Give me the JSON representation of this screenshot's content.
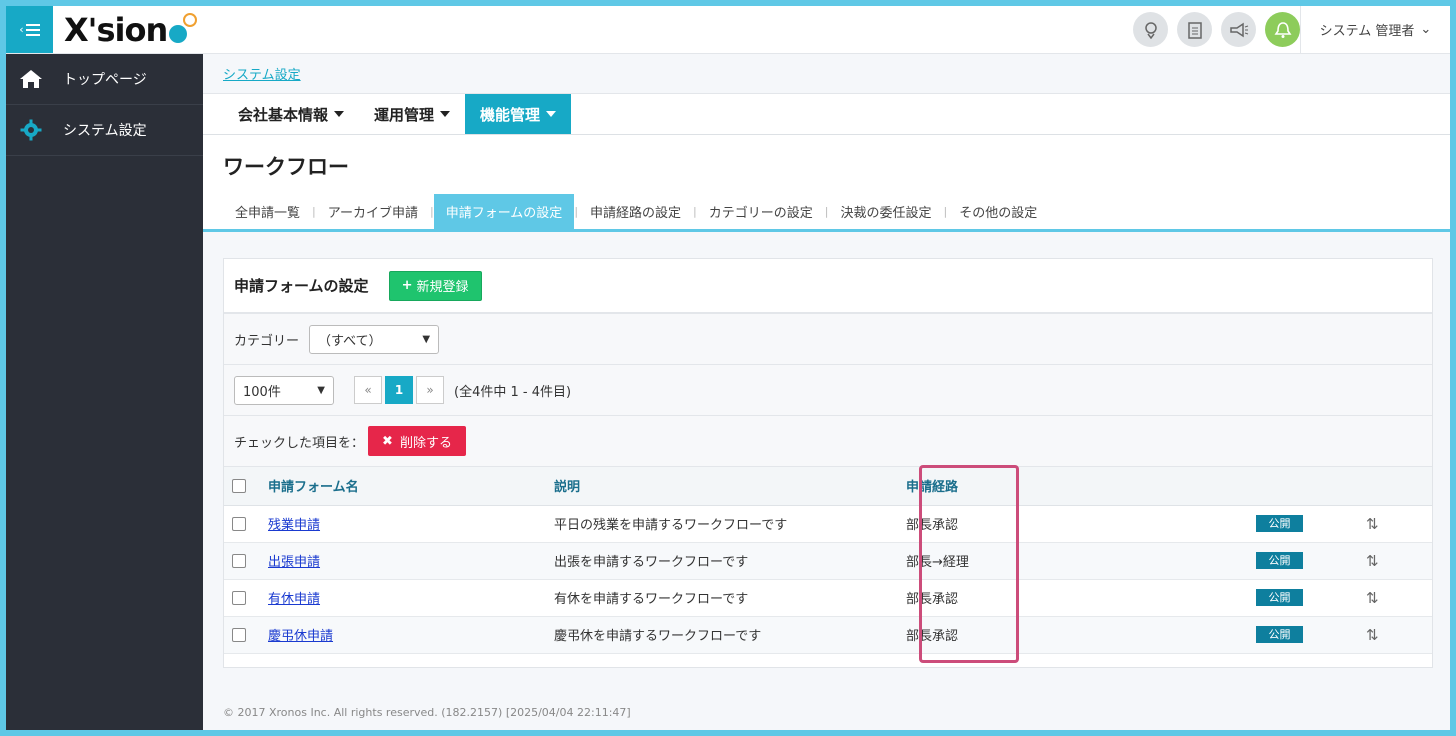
{
  "header": {
    "logo_text": "X'sion",
    "user_label": "システム 管理者",
    "icons": [
      "support-icon",
      "notepad-icon",
      "megaphone-icon",
      "bell-icon"
    ]
  },
  "sidebar": {
    "items": [
      {
        "label": "トップページ",
        "icon": "home-icon"
      },
      {
        "label": "システム設定",
        "icon": "gear-icon"
      }
    ]
  },
  "breadcrumb": {
    "label": "システム設定"
  },
  "mainnav": {
    "items": [
      {
        "label": "会社基本情報"
      },
      {
        "label": "運用管理"
      },
      {
        "label": "機能管理"
      }
    ]
  },
  "page": {
    "title": "ワークフロー",
    "subtabs": [
      "全申請一覧",
      "アーカイブ申請",
      "申請フォームの設定",
      "申請経路の設定",
      "カテゴリーの設定",
      "決裁の委任設定",
      "その他の設定"
    ]
  },
  "card": {
    "title": "申請フォームの設定",
    "new_button": "新規登録",
    "category_label": "カテゴリー",
    "category_value": "（すべて）",
    "per_page_value": "100件",
    "pager": {
      "prev": "«",
      "current": "1",
      "next": "»"
    },
    "range_text": "(全4件中 1 - 4件目)",
    "bulk_label": "チェックした項目を：",
    "delete_button": "削除する",
    "table": {
      "headers": [
        "申請フォーム名",
        "説明",
        "申請経路"
      ],
      "rows": [
        {
          "name": "残業申請",
          "desc": "平日の残業を申請するワークフローです",
          "route": "部長承認",
          "status": "公開"
        },
        {
          "name": "出張申請",
          "desc": "出張を申請するワークフローです",
          "route": "部長→経理",
          "status": "公開"
        },
        {
          "name": "有休申請",
          "desc": "有休を申請するワークフローです",
          "route": "部長承認",
          "status": "公開"
        },
        {
          "name": "慶弔休申請",
          "desc": "慶弔休を申請するワークフローです",
          "route": "部長承認",
          "status": "公開"
        }
      ]
    }
  },
  "footer": {
    "text": "© 2017 Xronos Inc. All rights reserved. (182.2157) [2025/04/04 22:11:47]"
  },
  "colors": {
    "accent": "#17a9c6",
    "success": "#1fc46e",
    "danger": "#e6264a",
    "highlight": "#cc4c7a",
    "sidebar": "#2b2f38"
  }
}
